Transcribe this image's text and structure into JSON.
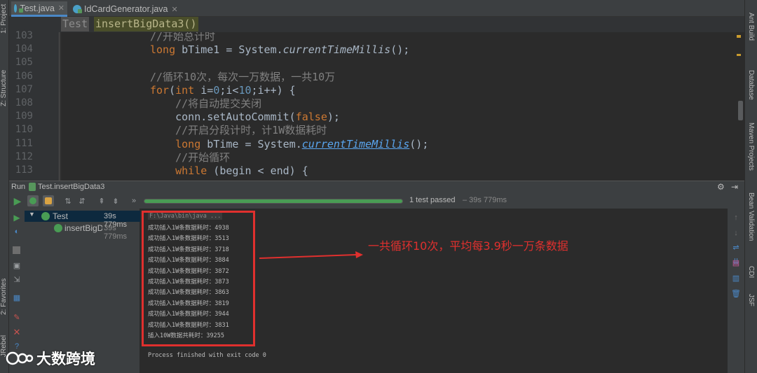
{
  "tabs": [
    {
      "label": "Test.java",
      "active": true
    },
    {
      "label": "IdCardGenerator.java",
      "active": false
    }
  ],
  "breadcrumb": [
    "Test",
    "insertBigData3()"
  ],
  "left_tools": [
    "1: Project",
    "Z: Structure",
    "2: Favorites",
    "JRebel"
  ],
  "right_tools": [
    "Ant Build",
    "Database",
    "Maven Projects",
    "Bean Validation",
    "CDI",
    "JSF"
  ],
  "editor": {
    "line_numbers": [
      "103",
      "104",
      "105",
      "106",
      "107",
      "108",
      "109",
      "110",
      "111",
      "112",
      "113"
    ],
    "lines": [
      {
        "indent": 8,
        "parts": [
          {
            "t": "//开始总计时",
            "c": "cm"
          }
        ]
      },
      {
        "indent": 8,
        "parts": [
          {
            "t": "long",
            "c": "kw"
          },
          {
            "t": " bTime1 = System."
          },
          {
            "t": "currentTimeMillis",
            "c": "it"
          },
          {
            "t": "();"
          }
        ]
      },
      {
        "indent": 0,
        "parts": []
      },
      {
        "indent": 8,
        "parts": [
          {
            "t": "//循环10次，每次一万数据，一共10万",
            "c": "cm"
          }
        ]
      },
      {
        "indent": 8,
        "parts": [
          {
            "t": "for",
            "c": "kw"
          },
          {
            "t": "("
          },
          {
            "t": "int",
            "c": "kw"
          },
          {
            "t": " i="
          },
          {
            "t": "0",
            "c": "num"
          },
          {
            "t": ";i<"
          },
          {
            "t": "10",
            "c": "num"
          },
          {
            "t": ";i++) {"
          }
        ]
      },
      {
        "indent": 12,
        "parts": [
          {
            "t": "//将自动提交关闭",
            "c": "cm"
          }
        ]
      },
      {
        "indent": 12,
        "parts": [
          {
            "t": "conn.setAutoCommit("
          },
          {
            "t": "false",
            "c": "kw"
          },
          {
            "t": ");"
          }
        ]
      },
      {
        "indent": 12,
        "parts": [
          {
            "t": "//开启分段计时，计1W数据耗时",
            "c": "cm"
          }
        ]
      },
      {
        "indent": 12,
        "parts": [
          {
            "t": "long",
            "c": "kw"
          },
          {
            "t": " bTime = System."
          },
          {
            "t": "currentTimeMillis",
            "c": "lk"
          },
          {
            "t": "();"
          }
        ]
      },
      {
        "indent": 12,
        "parts": [
          {
            "t": "//开始循环",
            "c": "cm"
          }
        ]
      },
      {
        "indent": 12,
        "parts": [
          {
            "t": "while",
            "c": "kw"
          },
          {
            "t": " (begin < end) {"
          }
        ]
      }
    ]
  },
  "run": {
    "label": "Run",
    "config": "Test.insertBigData3",
    "progress": 1.0,
    "status": "1 test passed",
    "status_time": "– 39s 779ms",
    "tree": [
      {
        "name": "Test",
        "time": "39s 779ms"
      },
      {
        "name": "insertBigD",
        "time": "39s 779ms"
      }
    ]
  },
  "console": {
    "command": "F:\\Java\\bin\\java ...",
    "lines": [
      "成功插入1W条数据耗时：4938",
      "成功插入1W条数据耗时：3513",
      "成功插入1W条数据耗时：3718",
      "成功插入1W条数据耗时：3884",
      "成功插入1W条数据耗时：3872",
      "成功插入1W条数据耗时：3873",
      "成功插入1W条数据耗时：3863",
      "成功插入1W条数据耗时：3819",
      "成功插入1W条数据耗时：3944",
      "成功插入1W条数据耗时：3831",
      "插入10W数据共耗时：39255"
    ],
    "finish": "Process finished with exit code 0"
  },
  "annotation": {
    "text": "一共循环10次，平均每3.9秒一万条数据",
    "color": "#e0302e"
  },
  "watermark": "大数跨境",
  "colors": {
    "accent": "#4a88c7",
    "pass": "#499c54",
    "highlight_box": "#e0302e"
  }
}
